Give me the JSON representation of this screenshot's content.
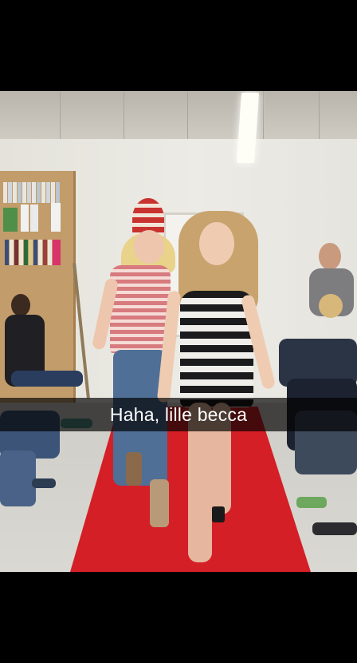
{
  "caption": {
    "text": "Haha, lille becca"
  },
  "colors": {
    "carpet": "#d41f26",
    "caption_bar": "rgba(0,0,0,0.68)",
    "letterbox": "#000000"
  }
}
